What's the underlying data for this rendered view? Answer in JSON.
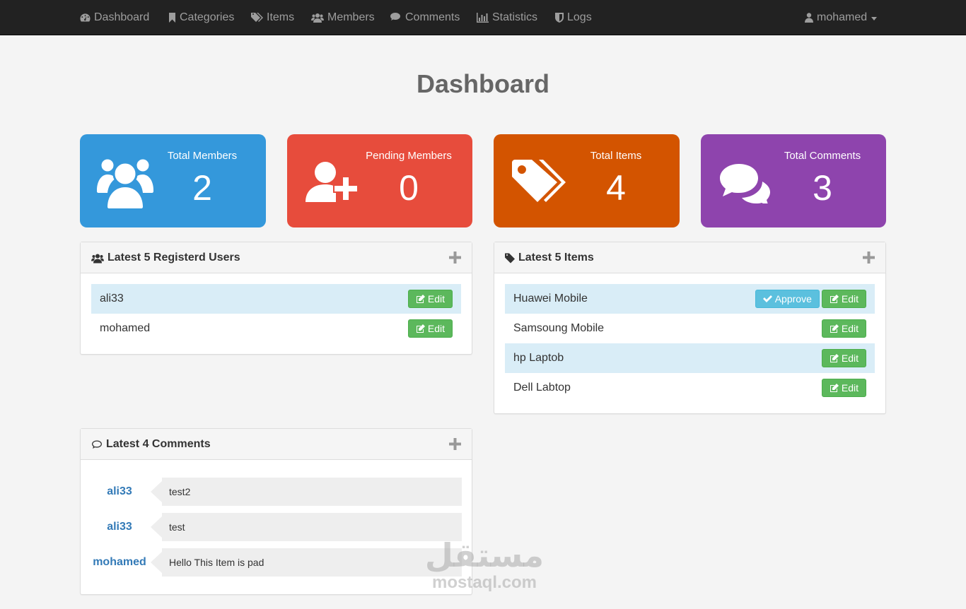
{
  "nav": {
    "items": [
      {
        "label": "Dashboard",
        "icon": "dashboard-icon"
      },
      {
        "label": "Categories",
        "icon": "bookmark-icon"
      },
      {
        "label": "Items",
        "icon": "tags-icon"
      },
      {
        "label": "Members",
        "icon": "users-icon"
      },
      {
        "label": "Comments",
        "icon": "comments-icon"
      },
      {
        "label": "Statistics",
        "icon": "bar-chart-icon"
      },
      {
        "label": "Logs",
        "icon": "shield-icon"
      }
    ],
    "user": "mohamed"
  },
  "page": {
    "title": "Dashboard"
  },
  "stats": [
    {
      "label": "Total Members",
      "value": "2",
      "color": "#3498db",
      "icon": "users-icon"
    },
    {
      "label": "Pending Members",
      "value": "0",
      "color": "#e74c3c",
      "icon": "user-plus-icon"
    },
    {
      "label": "Total Items",
      "value": "4",
      "color": "#d35400",
      "icon": "tags-icon"
    },
    {
      "label": "Total Comments",
      "value": "3",
      "color": "#8e44ad",
      "icon": "comments-icon"
    }
  ],
  "users_panel": {
    "title": "Latest 5 Registerd Users",
    "rows": [
      {
        "name": "ali33",
        "edit": "Edit"
      },
      {
        "name": "mohamed",
        "edit": "Edit"
      }
    ]
  },
  "items_panel": {
    "title": "Latest 5 Items",
    "rows": [
      {
        "name": "Huawei Mobile",
        "approve": "Approve",
        "edit": "Edit"
      },
      {
        "name": "Samsoung Mobile",
        "edit": "Edit"
      },
      {
        "name": "hp Laptob",
        "edit": "Edit"
      },
      {
        "name": "Dell Labtop",
        "edit": "Edit"
      }
    ]
  },
  "comments_panel": {
    "title": "Latest 4 Comments",
    "rows": [
      {
        "user": "ali33",
        "text": "test2"
      },
      {
        "user": "ali33",
        "text": "test"
      },
      {
        "user": "mohamed",
        "text": "Hello This Item is pad"
      }
    ]
  },
  "watermark": {
    "arabic": "مستقل",
    "latin": "mostaql.com"
  }
}
